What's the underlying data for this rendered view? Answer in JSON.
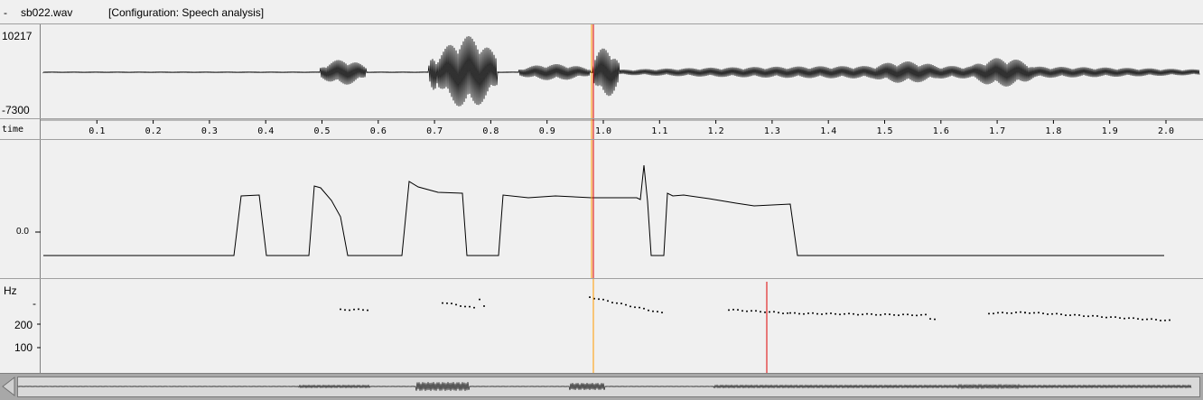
{
  "titlebar": {
    "dash": "-",
    "filename": "sb022.wav",
    "configuration": "[Configuration: Speech analysis]"
  },
  "waveform": {
    "ymax_label": "10217",
    "ymin_label": "-7300"
  },
  "time_axis": {
    "label": "time",
    "ticks": [
      "0.1",
      "0.2",
      "0.3",
      "0.4",
      "0.5",
      "0.6",
      "0.7",
      "0.8",
      "0.9",
      "1.0",
      "1.1",
      "1.2",
      "1.3",
      "1.4",
      "1.5",
      "1.6",
      "1.7",
      "1.8",
      "1.9",
      "2.0"
    ]
  },
  "contour": {
    "zero_label": "0.0"
  },
  "pitch": {
    "unit_label": "Hz",
    "tick_dash": "-",
    "label_200": "200",
    "label_100": "100"
  },
  "colors": {
    "cursor_red": "#e00000",
    "cursor_orange": "#ff9a00",
    "panel_bg": "#f0f0f0",
    "overview_bg": "#a8a8a8"
  }
}
